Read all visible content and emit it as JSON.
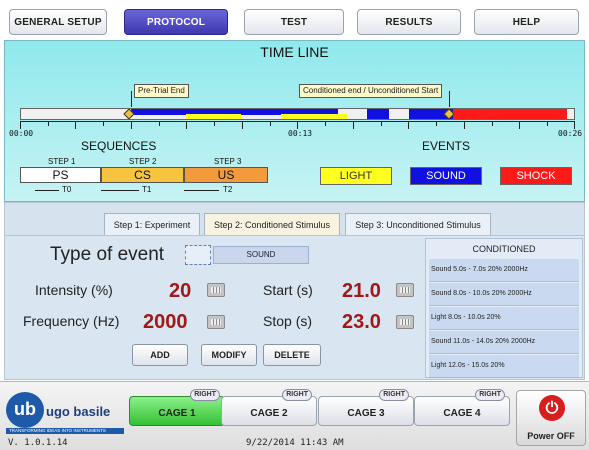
{
  "menu": {
    "tabs": [
      "GENERAL SETUP",
      "PROTOCOL",
      "TEST",
      "RESULTS",
      "HELP"
    ],
    "active": "PROTOCOL"
  },
  "timeline": {
    "title": "TIME LINE",
    "callouts": [
      "Pre-Trial End",
      "Conditioned end / Unconditioned Start"
    ],
    "time_labels": [
      "00:00",
      "00:13",
      "00:26"
    ],
    "sequences_title": "SEQUENCES",
    "events_title": "EVENTS",
    "steps": [
      {
        "label": "STEP 1",
        "code": "PS",
        "marker": "T0",
        "color": "#ffffff"
      },
      {
        "label": "STEP 2",
        "code": "CS",
        "marker": "T1",
        "color": "#f6c43e"
      },
      {
        "label": "STEP 3",
        "code": "US",
        "marker": "T2",
        "color": "#f39a3c"
      }
    ],
    "events": [
      {
        "label": "LIGHT",
        "color": "#ffff20",
        "text_color": "#333333"
      },
      {
        "label": "SOUND",
        "color": "#1010e0",
        "text_color": "#ffffff"
      },
      {
        "label": "SHOCK",
        "color": "#ff1a1a",
        "text_color": "#ffffff"
      }
    ]
  },
  "step_tabs": {
    "tabs": [
      "Step 1: Experiment",
      "Step 2: Conditioned Stimulus",
      "Step 3: Unconditioned Stimulus"
    ],
    "active": "Step 2: Conditioned Stimulus"
  },
  "form": {
    "type_label": "Type of event",
    "type_value": "SOUND",
    "intensity_label": "Intensity (%)",
    "intensity_value": "20",
    "frequency_label": "Frequency (Hz)",
    "frequency_value": "2000",
    "start_label": "Start (s)",
    "start_value": "21.0",
    "stop_label": "Stop (s)",
    "stop_value": "23.0",
    "buttons": [
      "ADD",
      "MODIFY",
      "DELETE"
    ]
  },
  "conditioned": {
    "header": "CONDITIONED",
    "items": [
      "Sound 5.0s - 7.0s 20% 2000Hz",
      "Sound 8.0s - 10.0s 20% 2000Hz",
      "Light 8.0s - 10.0s 20%",
      "Sound 11.0s - 14.0s 20% 2000Hz",
      "Light 12.0s - 15.0s 20%"
    ]
  },
  "footer": {
    "logo_text": "ugo basile",
    "logo_initials": "ub",
    "logo_tagline": "TRANSFORMING IDEAS INTO INSTRUMENTS",
    "cages": [
      {
        "label": "CAGE 1",
        "side": "RIGHT"
      },
      {
        "label": "CAGE 2",
        "side": "RIGHT"
      },
      {
        "label": "CAGE 3",
        "side": "RIGHT"
      },
      {
        "label": "CAGE 4",
        "side": "RIGHT"
      }
    ],
    "active_cage": "CAGE 1",
    "power_label": "Power OFF",
    "version": "V. 1.0.1.14",
    "datetime": "9/22/2014 11:43 AM"
  },
  "colors": {
    "menu_active": "#3d38b0",
    "timeline_bg": "#8fe9ec",
    "value_red": "#a01818",
    "cage_active": "#34c034",
    "power_red": "#d91e1e",
    "track_blue": "#1010e0",
    "track_yellow": "#ffff20",
    "track_red": "#ff1a1a"
  },
  "icons": [
    "keyboard-icon",
    "power-icon",
    "ub-logo"
  ]
}
